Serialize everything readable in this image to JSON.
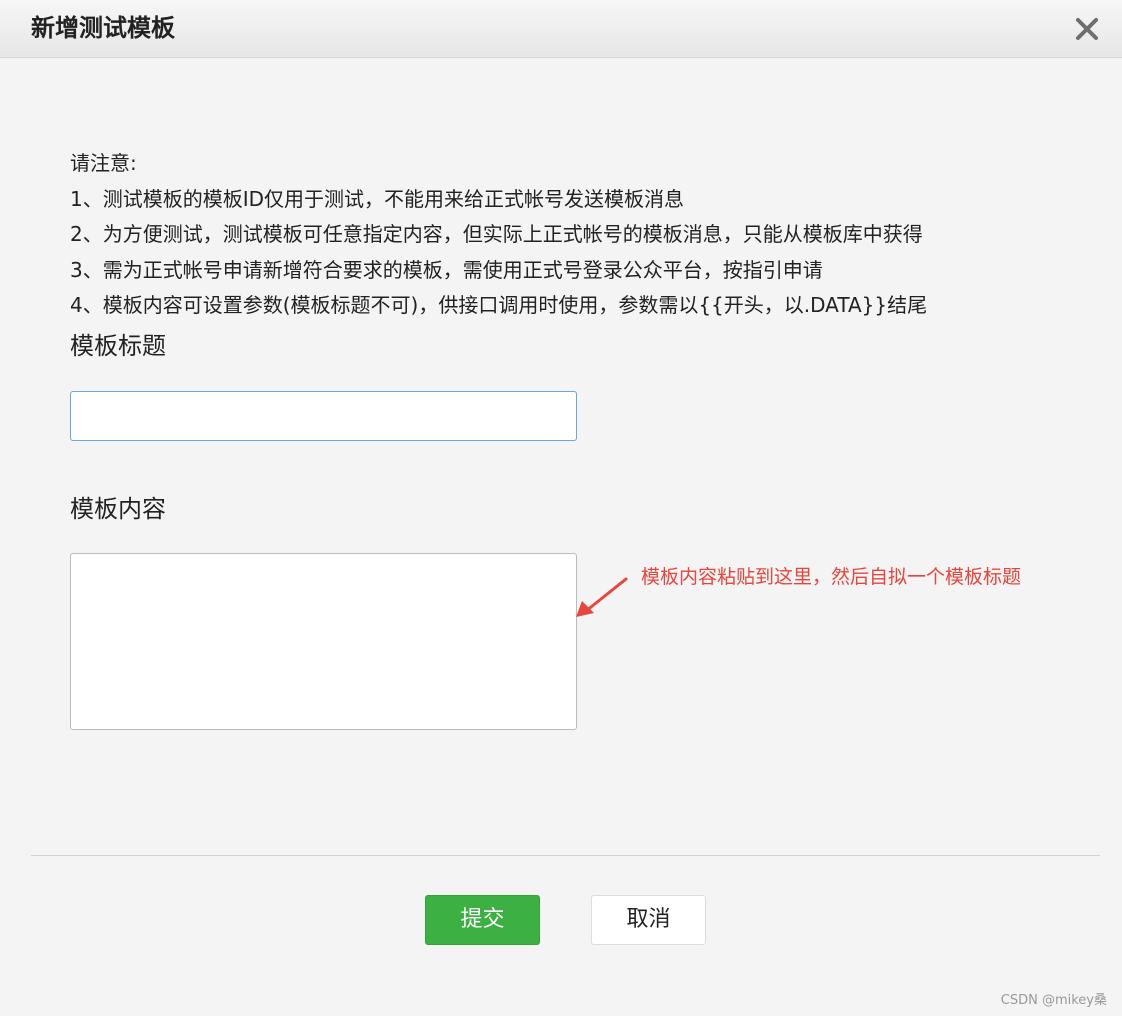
{
  "dialog": {
    "title": "新增测试模板",
    "close_icon": "close-icon"
  },
  "notice": {
    "heading": "请注意:",
    "items": [
      "1、测试模板的模板ID仅用于测试，不能用来给正式帐号发送模板消息",
      "2、为方便测试，测试模板可任意指定内容，但实际上正式帐号的模板消息，只能从模板库中获得",
      "3、需为正式帐号申请新增符合要求的模板，需使用正式号登录公众平台，按指引申请",
      "4、模板内容可设置参数(模板标题不可)，供接口调用时使用，参数需以{{开头，以.DATA}}结尾"
    ]
  },
  "form": {
    "title_label": "模板标题",
    "title_value": "",
    "content_label": "模板内容",
    "content_value": ""
  },
  "annotation": {
    "text": "模板内容粘贴到这里，然后自拟一个模板标题",
    "color": "#e8453c"
  },
  "footer": {
    "submit_label": "提交",
    "cancel_label": "取消",
    "submit_color": "#3cb043"
  },
  "watermark": "CSDN @mikey桑"
}
